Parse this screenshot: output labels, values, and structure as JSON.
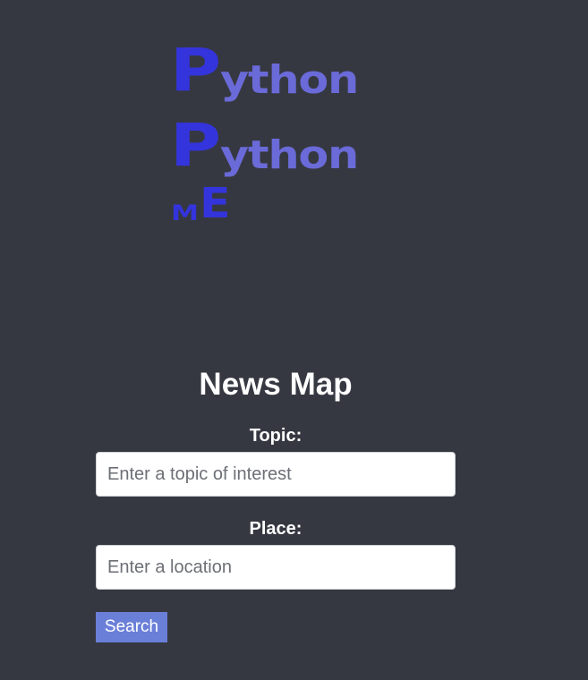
{
  "logo": {
    "line1_cap": "P",
    "line1_rest": "ython",
    "line2_cap": "P",
    "line2_rest": "ython",
    "line3_small": "M",
    "line3_large": "E"
  },
  "form": {
    "title": "News Map",
    "topic_label": "Topic:",
    "topic_placeholder": "Enter a topic of interest",
    "topic_value": "",
    "place_label": "Place:",
    "place_placeholder": "Enter a location",
    "place_value": "",
    "search_label": "Search"
  },
  "colors": {
    "background": "#363841",
    "logo_primary": "#3434dc",
    "logo_secondary": "#6a6ad8",
    "button": "#6a7fd8"
  }
}
